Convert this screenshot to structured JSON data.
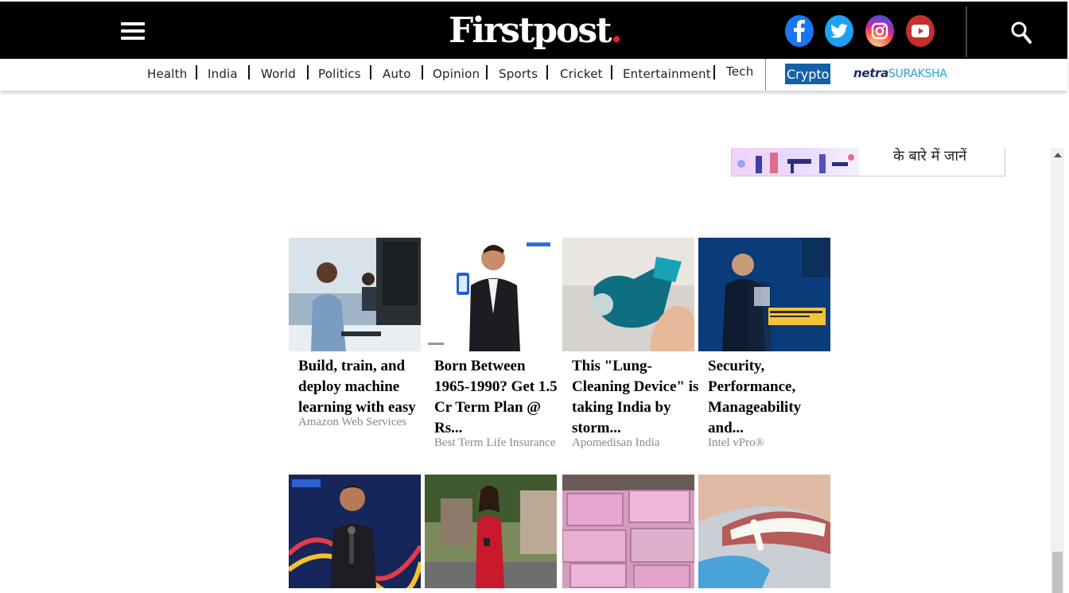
{
  "header": {
    "logo_text": "Firstpost",
    "logo_dot": ".",
    "social": [
      "facebook-icon",
      "twitter-icon",
      "instagram-icon",
      "youtube-icon"
    ]
  },
  "nav": {
    "items": [
      "Health",
      "India",
      "World",
      "Politics",
      "Auto",
      "Opinion",
      "Sports",
      "Cricket",
      "Entertainment",
      "Tech"
    ],
    "crypto": "Crypto",
    "netra_a": "netra",
    "netra_b": "SURAKSHA"
  },
  "banner": {
    "text": "के बारे में जानें"
  },
  "cards": [
    {
      "title": "Build, train, and deploy machine learning with easy",
      "source": "Amazon Web Services"
    },
    {
      "title": "Born Between 1965-1990? Get 1.5 Cr Term Plan @ Rs...",
      "source": "Best Term Life Insurance"
    },
    {
      "title": "This \"Lung-Cleaning Device\" is taking India by storm...",
      "source": "Apomedisan India"
    },
    {
      "title": "Security, Performance, Manageability and...",
      "source": "Intel vPro®"
    },
    {
      "title": "",
      "source": ""
    },
    {
      "title": "",
      "source": ""
    },
    {
      "title": "",
      "source": ""
    },
    {
      "title": "",
      "source": ""
    }
  ],
  "colors": {
    "topbar": "#000000",
    "accent_red": "#e3242b",
    "crypto_bg": "#1560a8"
  }
}
